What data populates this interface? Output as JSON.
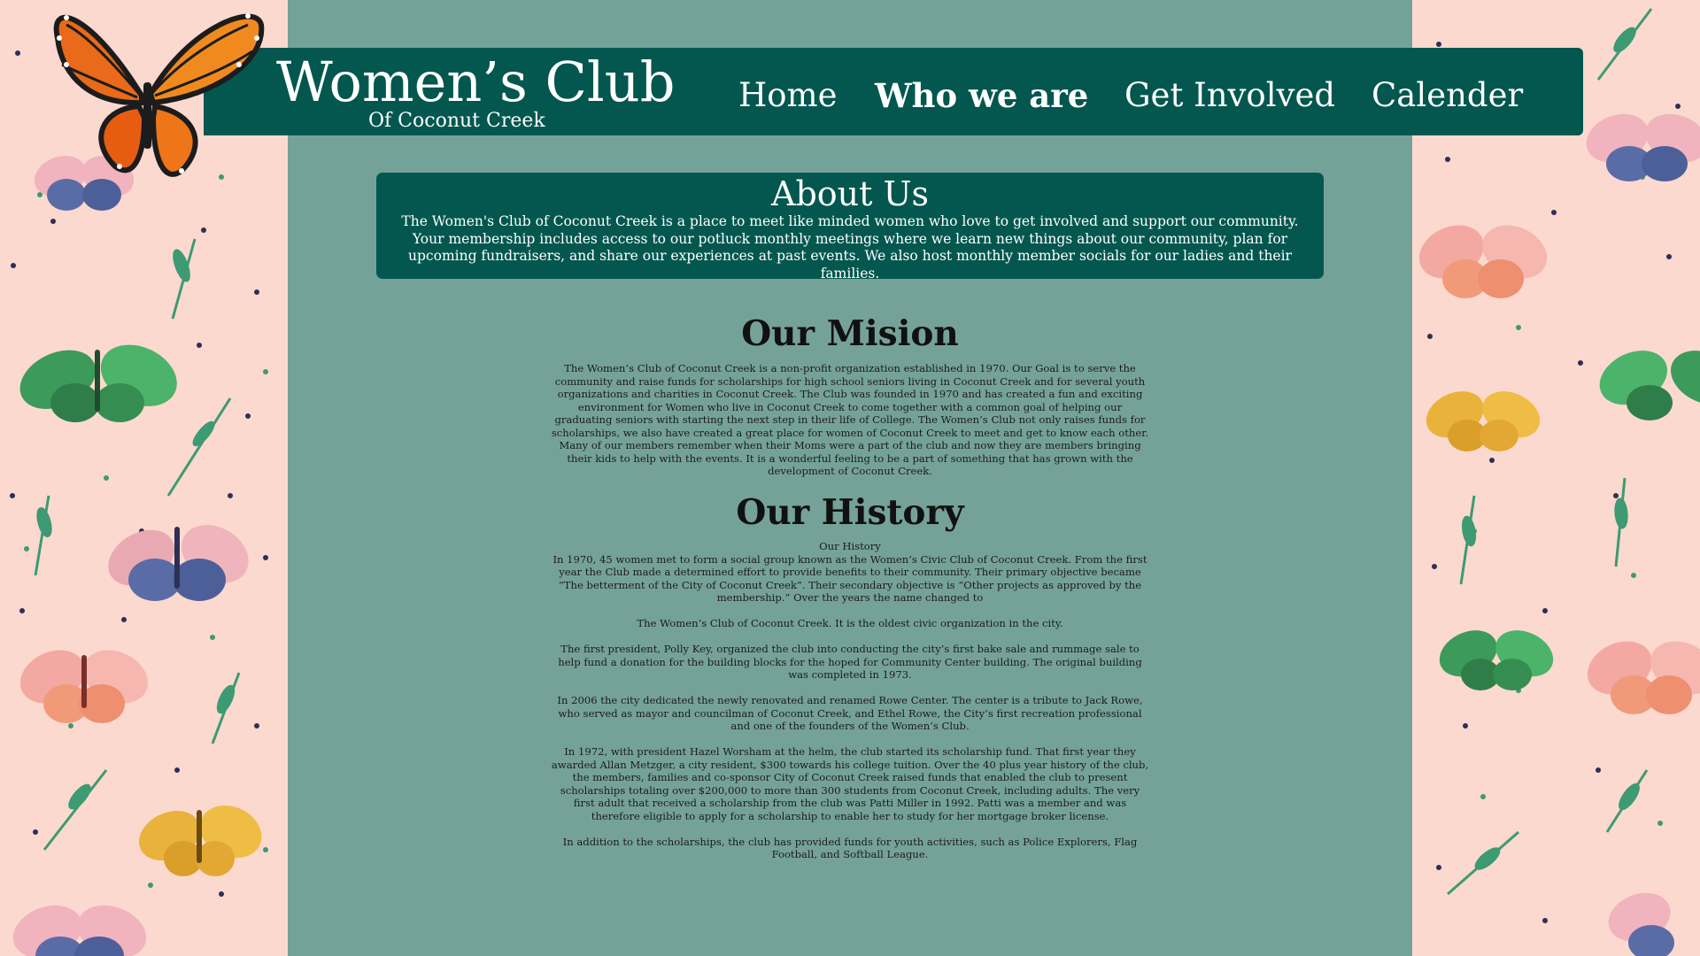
{
  "site": {
    "title": "Women’s Club",
    "subtitle": "Of Coconut Creek"
  },
  "nav": {
    "items": [
      {
        "label": "Home",
        "active": false
      },
      {
        "label": "Who we are",
        "active": true
      },
      {
        "label": "Get Involved",
        "active": false
      },
      {
        "label": "Calender",
        "active": false
      }
    ]
  },
  "about": {
    "title": "About Us",
    "text": "The Women's Club of Coconut Creek is a place to meet like minded women who love to get involved and support our community. Your membership includes access to our potluck monthly meetings where we learn new things about our community, plan for upcoming fundraisers, and share our experiences at past events. We also host monthly member socials for our ladies and their families."
  },
  "mission": {
    "title": "Our Mision",
    "text": "The Women’s Club of Coconut Creek is a non-profit organization established in 1970. Our Goal is to serve the community and raise funds for scholarships for high school seniors living in Coconut Creek and for several youth organizations and charities in Coconut Creek. The Club was founded in 1970 and has created a fun and exciting environment for Women who live in Coconut Creek to come together with a common goal of helping our graduating seniors with starting the next step in their life of College. The Women’s Club not only raises funds for scholarships, we also have created a great place for women of Coconut Creek to meet and get to know each other. Many of our members remember when their Moms were a part of the club and now they are members bringing their kids to help with the events. It is a wonderful feeling to be a part of something that has grown with the development of Coconut Creek."
  },
  "history": {
    "title": "Our History",
    "subheading": "Our History",
    "paragraphs": [
      "In 1970, 45 women met to form a social group known as the Women’s Civic Club of Coconut Creek. From the first year the Club made a determined effort to provide benefits to their community.  Their primary objective became “The betterment of the City of Coconut Creek”.  Their secondary objective is “Other projects as approved by the membership.” Over the years the name changed to",
      "The Women’s Club of Coconut Creek.  It is the oldest civic organization in the city.",
      "The first president, Polly Key, organized the club into conducting the city’s first bake sale and rummage sale to help fund a donation for the building blocks for the hoped for Community Center building.  The original building was completed in 1973.",
      "In 2006 the city dedicated the newly renovated and renamed Rowe Center.  The center is a tribute to Jack Rowe, who served as mayor and councilman of Coconut Creek, and Ethel Rowe, the City’s first recreation professional and one of the founders of the Women’s Club.",
      "In 1972, with president Hazel Worsham at the helm, the club started its scholarship fund.  That first year they awarded Allan Metzger, a city resident, $300 towards his college tuition.  Over the 40 plus year history of the club, the members, families and co-sponsor City of Coconut Creek raised funds that enabled the club to present scholarships totaling over $200,000 to more than 300 students from Coconut Creek, including adults. The very first adult that received a scholarship from the club was Patti Miller in 1992.  Patti was a member and was therefore eligible to apply for a scholarship to enable her to study for her mortgage broker license.",
      "In addition to the scholarships, the club has provided funds for youth activities, such as Police Explorers, Flag Football, and Softball League."
    ]
  },
  "colors": {
    "navbar": "#03574f",
    "content_bg": "#75a298",
    "side_bg": "#fbd9cf",
    "text_light": "#ffffff"
  },
  "icons": [
    "monarch-butterfly-logo",
    "butterfly-pattern"
  ]
}
